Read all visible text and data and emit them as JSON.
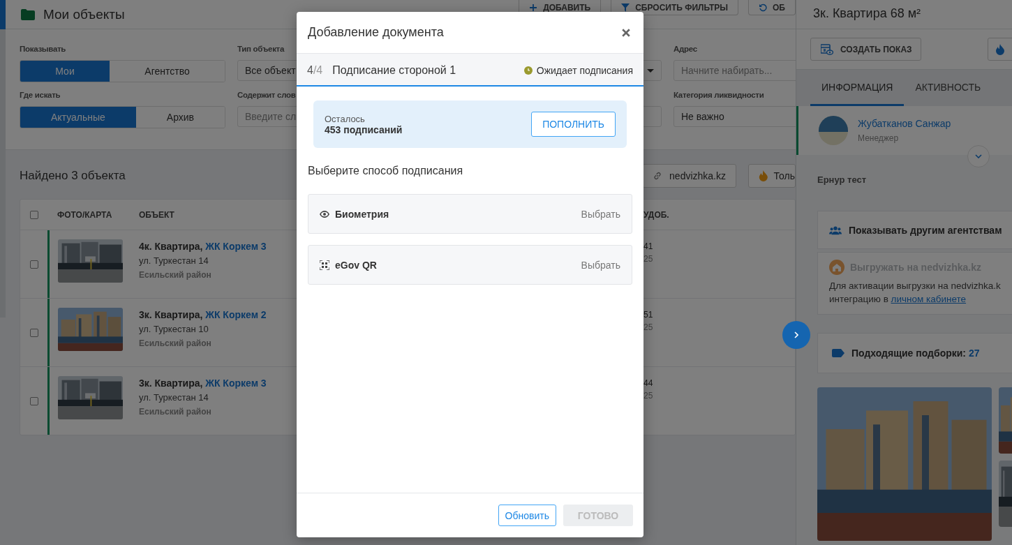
{
  "header": {
    "title": "Мои объекты",
    "buttons": [
      {
        "kind": "add",
        "label": "ДОБАВИТЬ"
      },
      {
        "kind": "filter",
        "label": "СБРОСИТЬ ФИЛЬТРЫ"
      },
      {
        "kind": "refresh",
        "label": "ОБ"
      }
    ]
  },
  "filters": [
    {
      "kind": "segmented",
      "label": "Показывать",
      "options": [
        {
          "label": "Мои",
          "selected": true
        },
        {
          "label": "Агентство",
          "selected": false
        }
      ]
    },
    {
      "kind": "select",
      "label": "Тип объекта",
      "value": "Все объект"
    },
    {
      "kind": "select",
      "caret": true
    },
    {
      "kind": "input",
      "label": "Адрес",
      "placeholder": "Начните набирать..."
    },
    {
      "kind": "segmented",
      "label": "Где искать",
      "options": [
        {
          "label": "Актуальные",
          "selected": true
        },
        {
          "label": "Архив",
          "selected": false
        }
      ]
    },
    {
      "kind": "input",
      "label": "Содержит слов",
      "placeholder": "Введите сл"
    },
    {
      "kind": "input"
    },
    {
      "kind": "select",
      "label": "Категория ликвидности",
      "value": "Не важно"
    }
  ],
  "found": {
    "text": "Найдено 3 объекта",
    "buttons": [
      {
        "kind": "link",
        "label": "nedvizhka.kz"
      },
      {
        "kind": "fire",
        "label": "Толь"
      }
    ]
  },
  "table": {
    "all_checked": false,
    "columns": [
      "ФОТО/КАРТА",
      "ОБЪЕКТ",
      "УДОБ."
    ],
    "rows": [
      {
        "checked": false,
        "title": "4к. Квартира,",
        "complex": "ЖК Коркем 3",
        "address": "ул. Туркестан 14",
        "district": "Есильский район",
        "column_4": [
          "41",
          "25"
        ]
      },
      {
        "checked": false,
        "title": "3к. Квартира,",
        "complex": "ЖК Коркем 2",
        "address": "ул. Туркестан 10",
        "district": "Есильский район",
        "column_4": [
          "51",
          "25"
        ]
      },
      {
        "checked": false,
        "title": "3к. Квартира,",
        "complex": "ЖК Коркем 3",
        "address": "ул. Туркестан 14",
        "district": "Есильский район",
        "column_4": [
          "44",
          "25"
        ]
      }
    ]
  },
  "panel": {
    "title": "3к. Квартира 68 м²",
    "create_button": "СОЗДАТЬ ПОКАЗ",
    "tabs": [
      {
        "label": "ИНФОРМАЦИЯ",
        "selected": true
      },
      {
        "label": "АКТИВНОСТЬ",
        "selected": false
      }
    ],
    "manager": {
      "name": "Жубатканов Санжар",
      "role": "Менеджер"
    },
    "note": "Ернур тест",
    "share": {
      "label": "Показывать другим агентствам"
    },
    "export": {
      "label": "Выгружать на nedvizhka.kz",
      "disabled": true,
      "text": "Для активации выгрузки на nedvizhka.k",
      "text_2": "интеграцию в",
      "link": "личном кабинете"
    },
    "collections": {
      "label": "Подходящие подборки:",
      "count": "27"
    }
  },
  "modal": {
    "title": "Добавление документа",
    "step": {
      "current": "4",
      "total": "/4",
      "title": "Подписание стороной 1",
      "status": "Ожидает подписания",
      "level": 1
    },
    "balance": {
      "label": "Осталось",
      "count": "453 подписаний",
      "button": "ПОПОЛНИТЬ"
    },
    "prompt": "Выберите способ подписания",
    "methods": [
      {
        "kind": "biometry",
        "label": "Биометрия",
        "action": "Выбрать"
      },
      {
        "kind": "qr",
        "label": "eGov QR",
        "action": "Выбрать"
      }
    ],
    "footer": [
      {
        "label": "Обновить",
        "disabled": false
      },
      {
        "label": "ГОТОВО",
        "disabled": true
      }
    ]
  }
}
